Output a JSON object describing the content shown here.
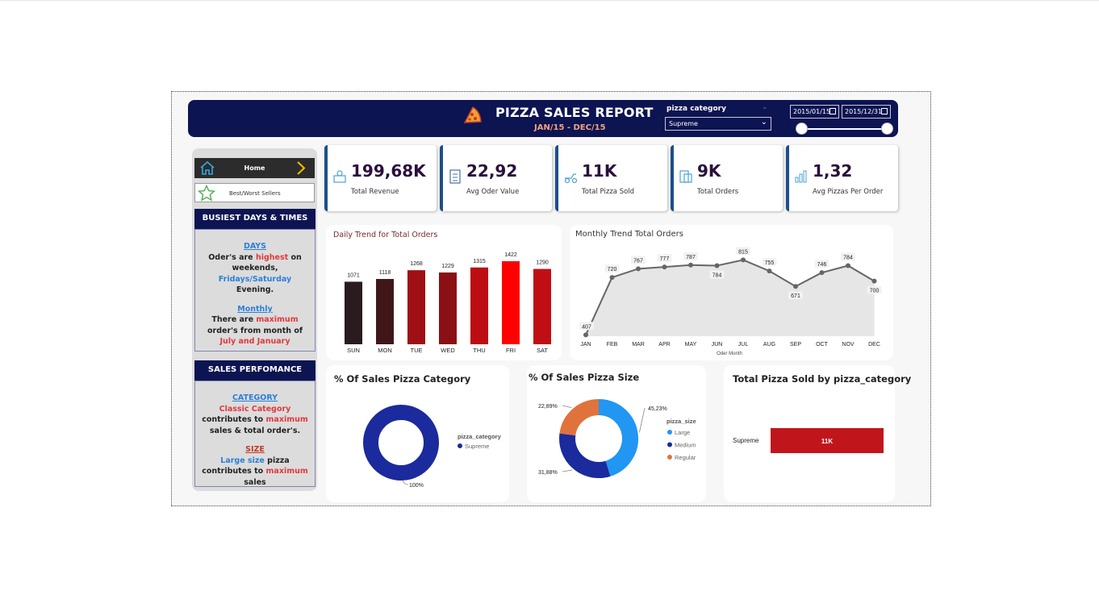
{
  "header": {
    "title": "PIZZA SALES  REPORT",
    "subtitle": "JAN/15 - DEC/15",
    "slicer_label": "pizza category",
    "slicer_value": "Supreme",
    "date_start": "2015/01/15",
    "date_end": "2015/12/31"
  },
  "nav": {
    "home": "Home",
    "best_worst": "Best/Worst Sellers"
  },
  "busiest": {
    "heading": "BUSIEST DAYS & TIMES",
    "days_title": "DAYS",
    "days_1": "Oder's are ",
    "days_2": "highest",
    "days_3": " on weekends, ",
    "days_4": "Fridays/Saturday",
    "days_5": " Evening.",
    "monthly_title": "Monthly",
    "monthly_1": "There are ",
    "monthly_2": "maximum",
    "monthly_3": " order's from month of ",
    "monthly_4": "July and January"
  },
  "performance": {
    "heading": "SALES PERFOMANCE",
    "category_title": "CATEGORY",
    "category_1": "Classic Category",
    "category_2": " contributes to ",
    "category_3": "maximum",
    "category_4": " sales & total order's.",
    "size_title": "SIZE",
    "size_1": "Large size",
    "size_2": " pizza contributes to ",
    "size_3": "maximum",
    "size_4": " sales"
  },
  "kpis": [
    {
      "value": "199,68K",
      "caption": "Total Revenue",
      "icon": "revenue-icon"
    },
    {
      "value": "22,92",
      "caption": "Avg Oder Value",
      "icon": "checklist-icon"
    },
    {
      "value": "11K",
      "caption": "Total Pizza Sold",
      "icon": "pizza-delivery-icon"
    },
    {
      "value": "9K",
      "caption": "Total Orders",
      "icon": "orders-icon"
    },
    {
      "value": "1,32",
      "caption": "Avg Pizzas Per Order",
      "icon": "bar-chart-icon"
    }
  ],
  "colors": {
    "header_bg": "#0c1452",
    "accent_red": "#e0393e",
    "accent_blue": "#2b7fd8",
    "donut_navy": "#1b2a9c",
    "size_orange": "#e0733b",
    "size_blue": "#2196f3"
  },
  "chart_data": [
    {
      "type": "bar",
      "title": "Daily Trend for Total Orders",
      "categories": [
        "SUN",
        "MON",
        "TUE",
        "WED",
        "THU",
        "FRI",
        "SAT"
      ],
      "values": [
        1071,
        1118,
        1268,
        1229,
        1315,
        1422,
        1290
      ],
      "colors": [
        "#2a1b1f",
        "#3f1719",
        "#9e1016",
        "#8a1015",
        "#bd0d12",
        "#ff0000",
        "#c00f14"
      ],
      "ylim": [
        0,
        1500
      ]
    },
    {
      "type": "area",
      "title": "Monthly Trend Total Orders",
      "xlabel": "Oder Month",
      "categories": [
        "JAN",
        "FEB",
        "MAR",
        "APR",
        "MAY",
        "JUN",
        "JUL",
        "AUG",
        "SEP",
        "OCT",
        "NOV",
        "DEC"
      ],
      "values": [
        407,
        720,
        767,
        777,
        787,
        784,
        815,
        755,
        671,
        746,
        784,
        700
      ],
      "ylim": [
        400,
        830
      ]
    },
    {
      "type": "pie",
      "title": "% Of Sales Pizza Category",
      "legend_title": "pizza_category",
      "slices": [
        {
          "name": "Supreme",
          "value": 100,
          "label": "100%"
        }
      ]
    },
    {
      "type": "pie",
      "title": "% Of Sales Pizza Size",
      "legend_title": "pizza_size",
      "slices": [
        {
          "name": "Large",
          "value": 45.23,
          "label": "45,23%"
        },
        {
          "name": "Medium",
          "value": 31.88,
          "label": "31,88%"
        },
        {
          "name": "Regular",
          "value": 22.89,
          "label": "22,89%"
        }
      ]
    },
    {
      "type": "bar",
      "title": "Total Pizza Sold by pizza_category",
      "categories": [
        "Supreme"
      ],
      "values": [
        "11K"
      ]
    }
  ]
}
